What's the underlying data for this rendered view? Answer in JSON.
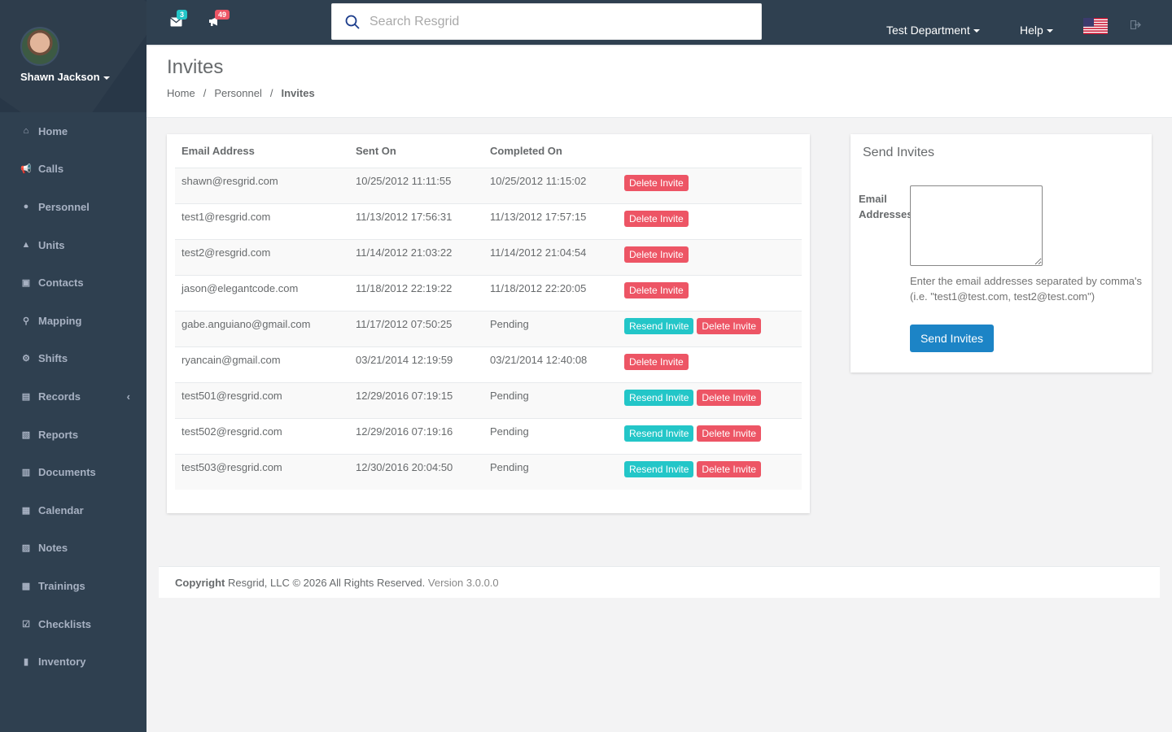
{
  "profile": {
    "name": "Shawn Jackson"
  },
  "sidebar": {
    "items": [
      {
        "label": "Home",
        "icon": "home-icon"
      },
      {
        "label": "Calls",
        "icon": "bullhorn-icon"
      },
      {
        "label": "Personnel",
        "icon": "user-icon"
      },
      {
        "label": "Units",
        "icon": "road-icon"
      },
      {
        "label": "Contacts",
        "icon": "address-book-icon"
      },
      {
        "label": "Mapping",
        "icon": "map-marker-icon"
      },
      {
        "label": "Shifts",
        "icon": "shifts-icon"
      },
      {
        "label": "Records",
        "icon": "file-icon"
      },
      {
        "label": "Reports",
        "icon": "reports-icon"
      },
      {
        "label": "Documents",
        "icon": "documents-icon"
      },
      {
        "label": "Calendar",
        "icon": "calendar-icon"
      },
      {
        "label": "Notes",
        "icon": "notes-icon"
      },
      {
        "label": "Trainings",
        "icon": "book-icon"
      },
      {
        "label": "Checklists",
        "icon": "checkbox-icon"
      },
      {
        "label": "Inventory",
        "icon": "barcode-icon"
      }
    ]
  },
  "topbar": {
    "messages_count": "3",
    "calls_count": "49",
    "search_placeholder": "Search Resgrid",
    "department": "Test Department",
    "help": "Help",
    "colors": {
      "messages_badge": "#23c6c8",
      "calls_badge": "#ed5565"
    }
  },
  "page": {
    "title": "Invites",
    "breadcrumb": [
      "Home",
      "Personnel",
      "Invites"
    ]
  },
  "table": {
    "headers": [
      "Email Address",
      "Sent On",
      "Completed On"
    ],
    "rows": [
      {
        "email": "shawn@resgrid.com",
        "sent": "10/25/2012 11:11:55",
        "completed": "10/25/2012 11:15:02",
        "resend": false
      },
      {
        "email": "test1@resgrid.com",
        "sent": "11/13/2012 17:56:31",
        "completed": "11/13/2012 17:57:15",
        "resend": false
      },
      {
        "email": "test2@resgrid.com",
        "sent": "11/14/2012 21:03:22",
        "completed": "11/14/2012 21:04:54",
        "resend": false
      },
      {
        "email": "jason@elegantcode.com",
        "sent": "11/18/2012 22:19:22",
        "completed": "11/18/2012 22:20:05",
        "resend": false
      },
      {
        "email": "gabe.anguiano@gmail.com",
        "sent": "11/17/2012 07:50:25",
        "completed": "Pending",
        "resend": true
      },
      {
        "email": "ryancain@gmail.com",
        "sent": "03/21/2014 12:19:59",
        "completed": "03/21/2014 12:40:08",
        "resend": false
      },
      {
        "email": "test501@resgrid.com",
        "sent": "12/29/2016 07:19:15",
        "completed": "Pending",
        "resend": true
      },
      {
        "email": "test502@resgrid.com",
        "sent": "12/29/2016 07:19:16",
        "completed": "Pending",
        "resend": true
      },
      {
        "email": "test503@resgrid.com",
        "sent": "12/30/2016 20:04:50",
        "completed": "Pending",
        "resend": true
      }
    ],
    "resend_label": "Resend Invite",
    "delete_label": "Delete Invite"
  },
  "invite_form": {
    "title": "Send Invites",
    "label": "Email Addresses",
    "help": "Enter the email addresses separated by comma's (i.e. \"test1@test.com, test2@test.com\")",
    "button": "Send Invites"
  },
  "footer": {
    "copyright_bold": "Copyright",
    "copyright_text": "Resgrid, LLC © 2026 All Rights Reserved.",
    "version": "Version 3.0.0.0"
  }
}
